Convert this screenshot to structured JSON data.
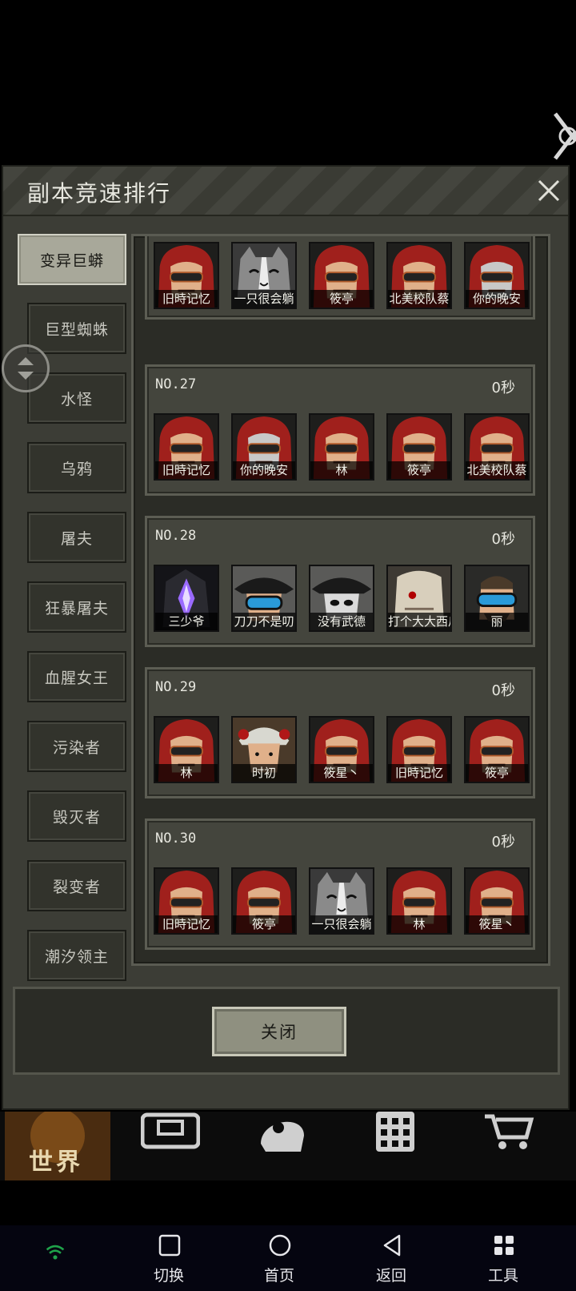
{
  "dialog": {
    "title": "副本竞速排行",
    "close_label": "关闭"
  },
  "sidebar": {
    "tabs": [
      {
        "label": "变异巨蟒",
        "active": true
      },
      {
        "label": "巨型蜘蛛"
      },
      {
        "label": "水怪"
      },
      {
        "label": "乌鸦"
      },
      {
        "label": "屠夫"
      },
      {
        "label": "狂暴屠夫"
      },
      {
        "label": "血腥女王"
      },
      {
        "label": "污染者"
      },
      {
        "label": "毁灭者"
      },
      {
        "label": "裂变者"
      },
      {
        "label": "潮汐领主"
      }
    ]
  },
  "ranks": [
    {
      "no": "",
      "time": "",
      "players": [
        {
          "name": "旧時记忆",
          "avatar": "red-hood-avatar"
        },
        {
          "name": "一只很会躺",
          "avatar": "cat-avatar"
        },
        {
          "name": "筱亭",
          "avatar": "red-hood-avatar"
        },
        {
          "name": "北美校队蔡",
          "avatar": "red-hood-avatar"
        },
        {
          "name": "你的晚安",
          "avatar": "red-hood-mask-avatar"
        }
      ]
    },
    {
      "no": "NO.27",
      "time": "0秒",
      "players": [
        {
          "name": "旧時记忆",
          "avatar": "red-hood-avatar"
        },
        {
          "name": "你的晚安",
          "avatar": "red-hood-mask-avatar"
        },
        {
          "name": "林",
          "avatar": "red-hood-avatar"
        },
        {
          "name": "筱亭",
          "avatar": "red-hood-avatar"
        },
        {
          "name": "北美校队蔡",
          "avatar": "red-hood-avatar"
        }
      ]
    },
    {
      "no": "NO.28",
      "time": "0秒",
      "players": [
        {
          "name": "三少爷",
          "avatar": "crystal-avatar"
        },
        {
          "name": "刀刀不是叨",
          "avatar": "pirate-goggles-avatar"
        },
        {
          "name": "没有武德",
          "avatar": "pirate-mask-avatar"
        },
        {
          "name": "打个大大西瓜",
          "avatar": "sack-mask-avatar"
        },
        {
          "name": "丽",
          "avatar": "goggles-avatar"
        }
      ]
    },
    {
      "no": "NO.29",
      "time": "0秒",
      "players": [
        {
          "name": "林",
          "avatar": "red-hood-avatar"
        },
        {
          "name": "时初",
          "avatar": "opera-avatar"
        },
        {
          "name": "筱星丶",
          "avatar": "red-hood-avatar"
        },
        {
          "name": "旧時记忆",
          "avatar": "red-hood-avatar"
        },
        {
          "name": "筱亭",
          "avatar": "red-hood-avatar"
        }
      ]
    },
    {
      "no": "NO.30",
      "time": "0秒",
      "players": [
        {
          "name": "旧時记忆",
          "avatar": "red-hood-avatar"
        },
        {
          "name": "筱亭",
          "avatar": "red-hood-avatar"
        },
        {
          "name": "一只很会躺",
          "avatar": "cat-avatar"
        },
        {
          "name": "林",
          "avatar": "red-hood-avatar"
        },
        {
          "name": "筱星丶",
          "avatar": "red-hood-avatar"
        }
      ]
    }
  ],
  "game_nav": {
    "world_label": "世界",
    "icons": [
      "backpack-icon",
      "head-gear-icon",
      "building-icon",
      "cart-icon"
    ]
  },
  "system_nav": {
    "items": [
      {
        "label": "",
        "icon": "wifi-icon"
      },
      {
        "label": "切换",
        "icon": "square-icon"
      },
      {
        "label": "首页",
        "icon": "circle-icon"
      },
      {
        "label": "返回",
        "icon": "triangle-icon"
      },
      {
        "label": "工具",
        "icon": "grid-icon"
      }
    ]
  },
  "colors": {
    "hood_red": "#a0201c",
    "panel_bg": "#3c3d36",
    "world_tab": "#4a2c10"
  }
}
